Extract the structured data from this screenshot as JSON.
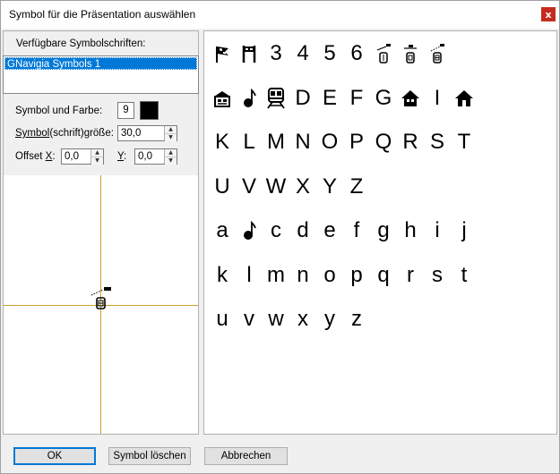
{
  "window": {
    "title": "Symbol für die Präsentation auswählen",
    "close_label": "x"
  },
  "fonts": {
    "label": "Verfügbare Symbolschriften:",
    "items": [
      "GNavigia Symbols 1"
    ]
  },
  "settings": {
    "symbol_color_label": "Symbol und Farbe:",
    "symbol_value": "9",
    "symbol_color": "#000000",
    "size_label_pre": "Symbol",
    "size_label_post": "(schrift)größe:",
    "size_value": "30,0",
    "offset_x_label_pre": "Offset ",
    "offset_x_label_u": "X",
    "offset_x_label_post": ":",
    "offset_x_value": "0,0",
    "offset_y_label_u": "Y",
    "offset_y_label_post": ":",
    "offset_y_value": "0,0"
  },
  "symbols": {
    "rows": [
      [
        "flag-icon",
        "gate-icon",
        "3",
        "4",
        "5",
        "6",
        "beacon-1-icon",
        "beacon-2-icon",
        "beacon-3-icon"
      ],
      [
        "building-icon",
        "note-icon",
        "train-icon",
        "D",
        "E",
        "F",
        "G",
        "house-icon",
        "I",
        "home-icon"
      ],
      [
        "K",
        "L",
        "M",
        "N",
        "O",
        "P",
        "Q",
        "R",
        "S",
        "T"
      ],
      [
        "U",
        "V",
        "W",
        "X",
        "Y",
        "Z"
      ],
      [
        "a",
        "note-icon",
        "c",
        "d",
        "e",
        "f",
        "g",
        "h",
        "i",
        "j"
      ],
      [
        "k",
        "l",
        "m",
        "n",
        "o",
        "p",
        "q",
        "r",
        "s",
        "t"
      ],
      [
        "u",
        "v",
        "w",
        "x",
        "y",
        "z"
      ]
    ]
  },
  "buttons": {
    "ok": "OK",
    "delete": "Symbol löschen",
    "cancel": "Abbrechen"
  },
  "colors": {
    "accent": "#0078d7",
    "crosshair": "#c9a227",
    "close": "#c42b1c"
  }
}
